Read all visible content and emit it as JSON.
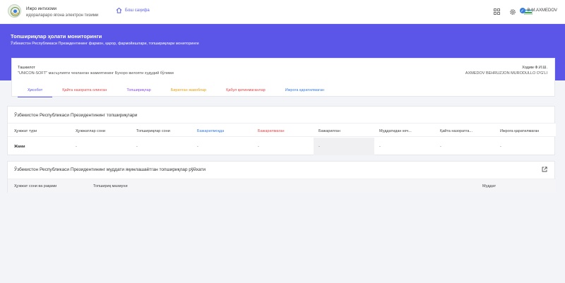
{
  "header": {
    "app_name_line1": "Ижро интизоми",
    "app_name_line2": "идоралараро ягона электрон тизими",
    "home_label": "Бош саҳифа",
    "user_name": "B.M.AXMEDOV",
    "icons": [
      "grid-icon",
      "gear-icon",
      "flag-icon",
      "verified-icon"
    ]
  },
  "banner": {
    "title": "Топшириқлар ҳолати мониторинги",
    "subtitle": "Ўзбекистон Республикаси Президентининг фармон, қарор, фармойишлари, топшириқлари мониторинги",
    "color": "#5b55e8"
  },
  "info": {
    "org_label": "Ташкилот",
    "org_value": "\"UNICON-SOFT\" масъулияти чекланган жамиятининг Бухоро вилояти худудий бўлими",
    "emp_label": "Ходим Ф.И.Ш.",
    "emp_value": "AXMEDOV BEHRUZJON MURODULLO O'G'LI"
  },
  "tabs": [
    {
      "label": "Ҳисобот",
      "color": "#5b55e8"
    },
    {
      "label": "Қайта назоратга олинган",
      "color": "#e0484b"
    },
    {
      "label": "Топшириқлар",
      "color": "#8a4fe0"
    },
    {
      "label": "Бирилган жавоблар",
      "color": "#e3a21a"
    },
    {
      "label": "Қабул қилинмаганлар",
      "color": "#e0484b"
    },
    {
      "label": "Ижрога қаратилмаган",
      "color": "#3b7ddd"
    }
  ],
  "table": {
    "title": "Ўзбекистон Республикаси Президентининг топшириқлари",
    "headers": [
      {
        "label": "Ҳужжат тури",
        "color": "#444444"
      },
      {
        "label": "Ҳужжатлар сони",
        "color": "#444444"
      },
      {
        "label": "Топшириқлар сони",
        "color": "#444444"
      },
      {
        "label": "Бажарилмоқда",
        "color": "#3b7ddd"
      },
      {
        "label": "Бажарилмаган",
        "color": "#e0484b"
      },
      {
        "label": "Бажарилган",
        "color": "#444444"
      },
      {
        "label": "Муддатидан кеч...",
        "color": "#444444"
      },
      {
        "label": "Қайта назоратга...",
        "color": "#444444"
      },
      {
        "label": "Ижрога қаратилмаган",
        "color": "#444444"
      }
    ],
    "row": [
      "Жами",
      "-",
      "-",
      "-",
      "-",
      "-",
      "-",
      "-",
      "-"
    ]
  },
  "list": {
    "title": "Ўзбекистон Республикаси Президентининг муддати яқинлашаётган топшириқлар рўйхати",
    "headers": [
      "Ҳужжат сони ва рақами",
      "Топшириқ мазмуни",
      "Муддат"
    ]
  }
}
